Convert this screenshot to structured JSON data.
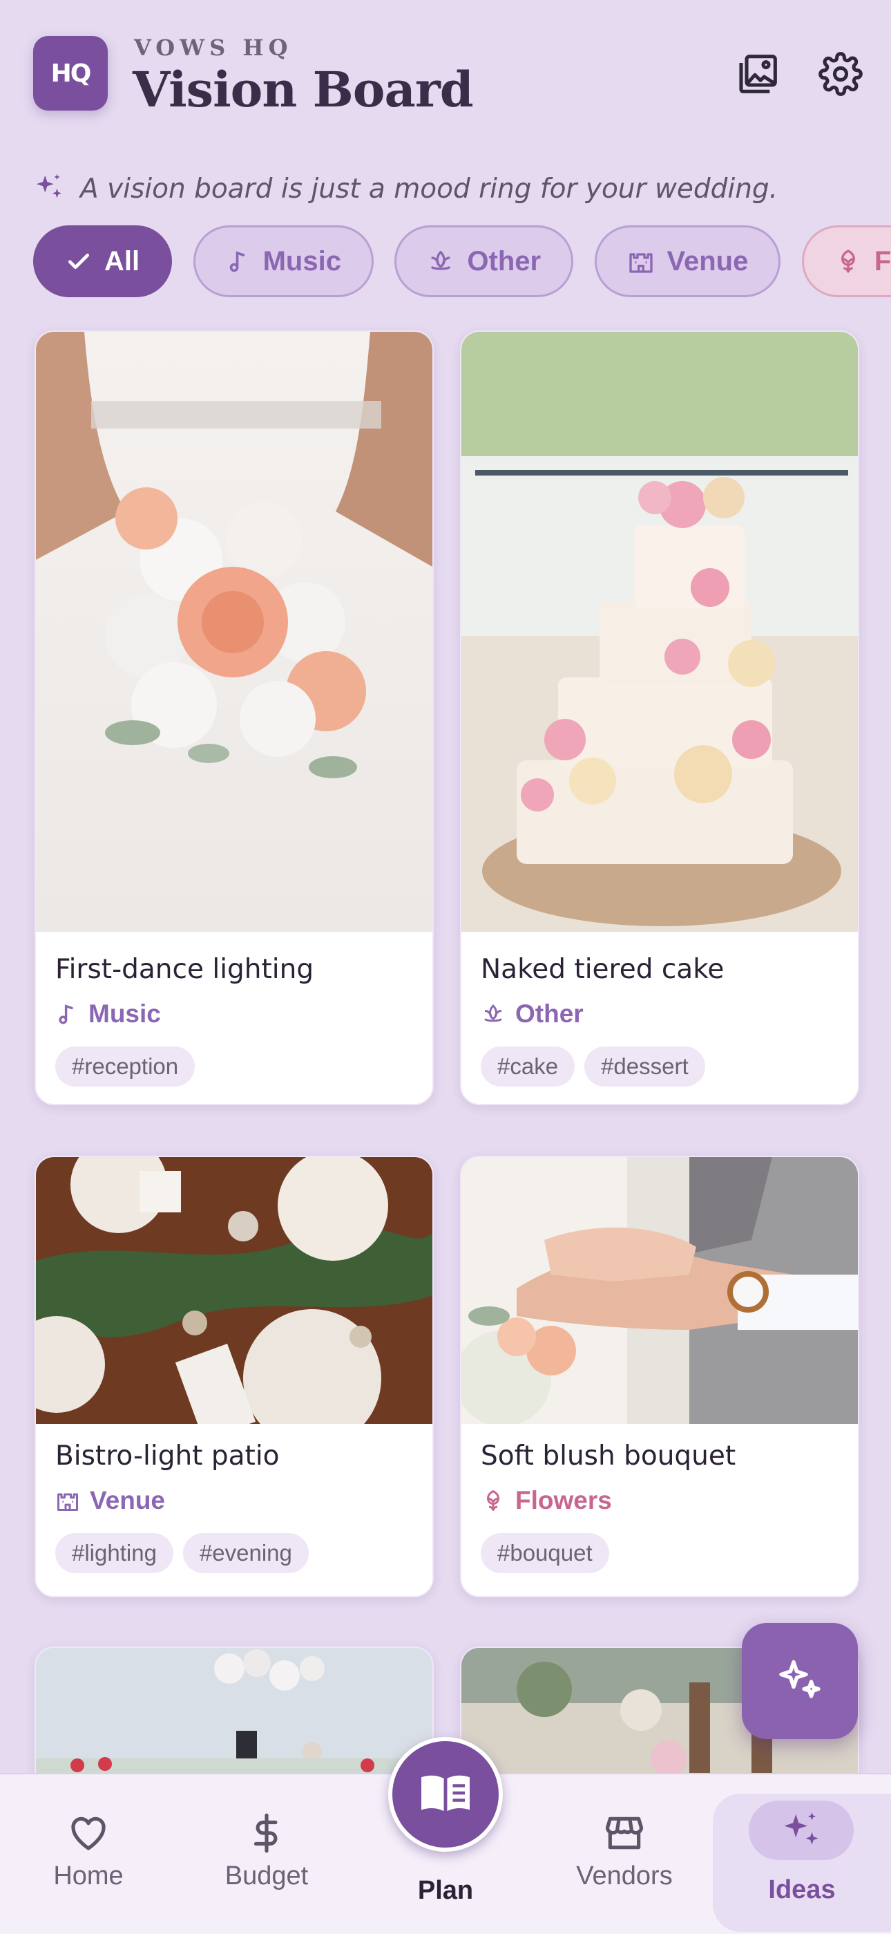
{
  "header": {
    "logo_text": "HQ",
    "eyebrow": "VOWS HQ",
    "title": "Vision Board",
    "gallery_icon": "gallery-icon",
    "settings_icon": "gear-icon"
  },
  "tagline": "A vision board is just a mood ring for your wedding.",
  "filters": [
    {
      "label": "All",
      "icon": "check-icon",
      "active": true
    },
    {
      "label": "Music",
      "icon": "music-note-icon"
    },
    {
      "label": "Other",
      "icon": "lotus-icon"
    },
    {
      "label": "Venue",
      "icon": "castle-icon"
    },
    {
      "label": "Flowers",
      "icon": "flower-icon"
    }
  ],
  "cards": [
    {
      "title": "First-dance lighting",
      "category": "Music",
      "tags": [
        "#reception"
      ]
    },
    {
      "title": "Naked tiered cake",
      "category": "Other",
      "tags": [
        "#cake",
        "#dessert"
      ]
    },
    {
      "title": "Bistro-light patio",
      "category": "Venue",
      "tags": [
        "#lighting",
        "#evening"
      ]
    },
    {
      "title": "Soft blush bouquet",
      "category": "Flowers",
      "tags": [
        "#bouquet"
      ]
    }
  ],
  "nav": {
    "home": "Home",
    "budget": "Budget",
    "plan": "Plan",
    "vendors": "Vendors",
    "ideas": "Ideas"
  },
  "colors": {
    "background": "#e5daf0",
    "accent": "#7a4f9e",
    "flowers_accent": "#c7668f"
  }
}
